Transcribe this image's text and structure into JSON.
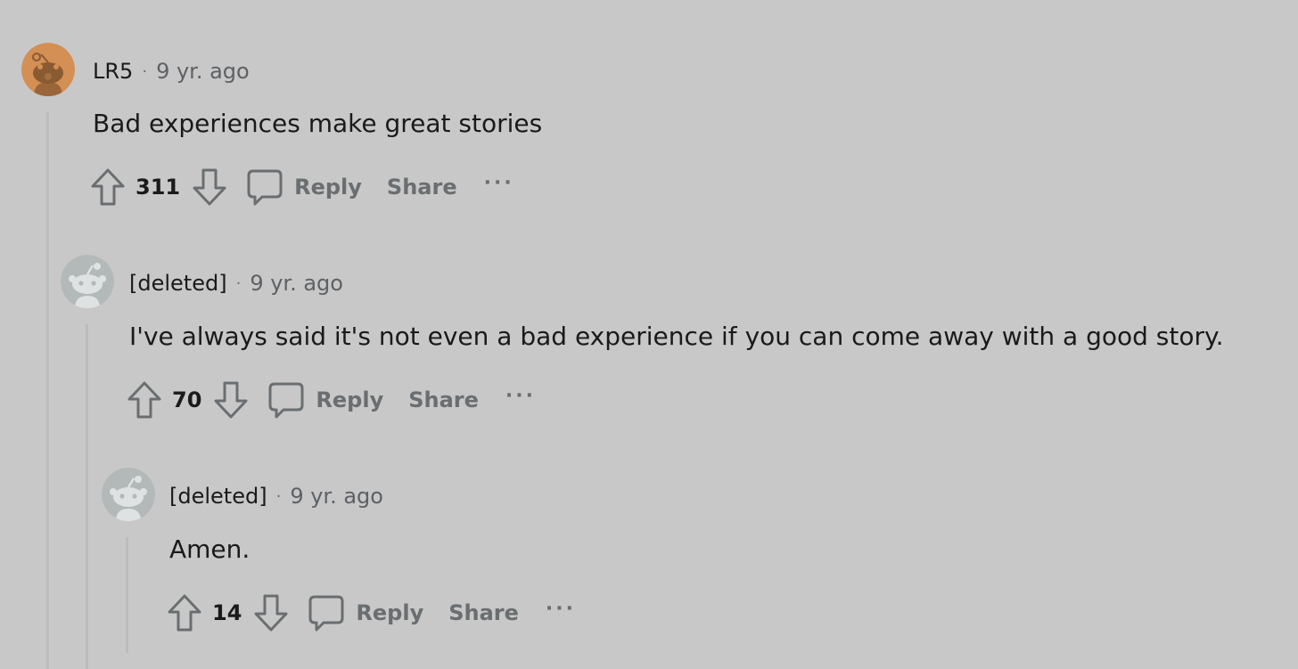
{
  "comments": [
    {
      "author": "LR5",
      "separator": "·",
      "age": "9 yr. ago",
      "body": "Bad experiences make great stories",
      "score": "311",
      "reply_label": "Reply",
      "share_label": "Share",
      "more_label": "···",
      "avatar_style": "orange-snoo"
    },
    {
      "author": "[deleted]",
      "separator": "·",
      "age": "9 yr. ago",
      "body": "I've always said it's not even a bad experience if you can come away with a good story.",
      "score": "70",
      "reply_label": "Reply",
      "share_label": "Share",
      "more_label": "···",
      "avatar_style": "gray-snoo"
    },
    {
      "author": "[deleted]",
      "separator": "·",
      "age": "9 yr. ago",
      "body": "Amen.",
      "score": "14",
      "reply_label": "Reply",
      "share_label": "Share",
      "more_label": "···",
      "avatar_style": "gray-snoo"
    }
  ],
  "colors": {
    "background": "#c8c8c8",
    "text": "#1a1a1b",
    "muted": "#6a6e70",
    "thread_line": "#b9bdbd",
    "orange_avatar": "#d38f54",
    "gray_avatar": "#b3b8b9"
  },
  "icons": [
    "upvote-icon",
    "downvote-icon",
    "comment-icon",
    "more-icon",
    "snoo-avatar-icon"
  ]
}
